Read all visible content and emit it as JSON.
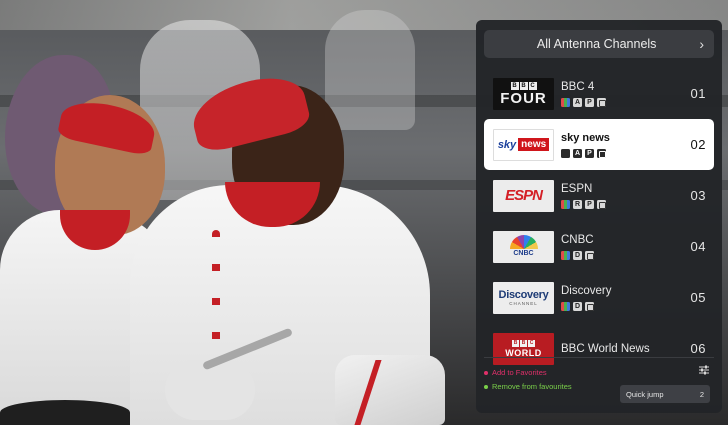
{
  "panel": {
    "header_title": "All Antenna Channels",
    "header_icon": "chevron-right-icon",
    "channels": [
      {
        "number": "01",
        "name": "BBC 4",
        "logo": "BBC FOUR",
        "badges": [
          "color",
          "A",
          "P",
          "guide"
        ]
      },
      {
        "number": "02",
        "name": "sky news",
        "logo": "sky news",
        "badges": [
          "color",
          "A",
          "P",
          "guide"
        ],
        "selected": true
      },
      {
        "number": "03",
        "name": "ESPN",
        "logo": "ESPN",
        "badges": [
          "color",
          "R",
          "P",
          "guide"
        ]
      },
      {
        "number": "04",
        "name": "CNBC",
        "logo": "CNBC",
        "badges": [
          "color",
          "D",
          "guide"
        ]
      },
      {
        "number": "05",
        "name": "Discovery",
        "logo": "Discovery",
        "badges": [
          "color",
          "D",
          "guide"
        ]
      },
      {
        "number": "06",
        "name": "BBC World News",
        "logo": "BBC WORLD",
        "badges": []
      }
    ],
    "footer": {
      "add_label": "Add to Favorites",
      "remove_label": "Remove from favourites",
      "quick_jump_label": "Quick jump",
      "quick_jump_value": "2"
    }
  },
  "logos": {
    "bbc_letters": [
      "B",
      "B",
      "C"
    ],
    "four": "FOUR",
    "sky": "sky",
    "news": "news",
    "espn": "ESPN",
    "cnbc": "CNBC",
    "discovery": "Discovery",
    "discovery_sub": "CHANNEL",
    "world": "WORLD"
  },
  "colors": {
    "panel_bg": "#222428",
    "selected_bg": "#ffffff",
    "add_color": "#e0306a",
    "remove_color": "#7ad04a"
  }
}
